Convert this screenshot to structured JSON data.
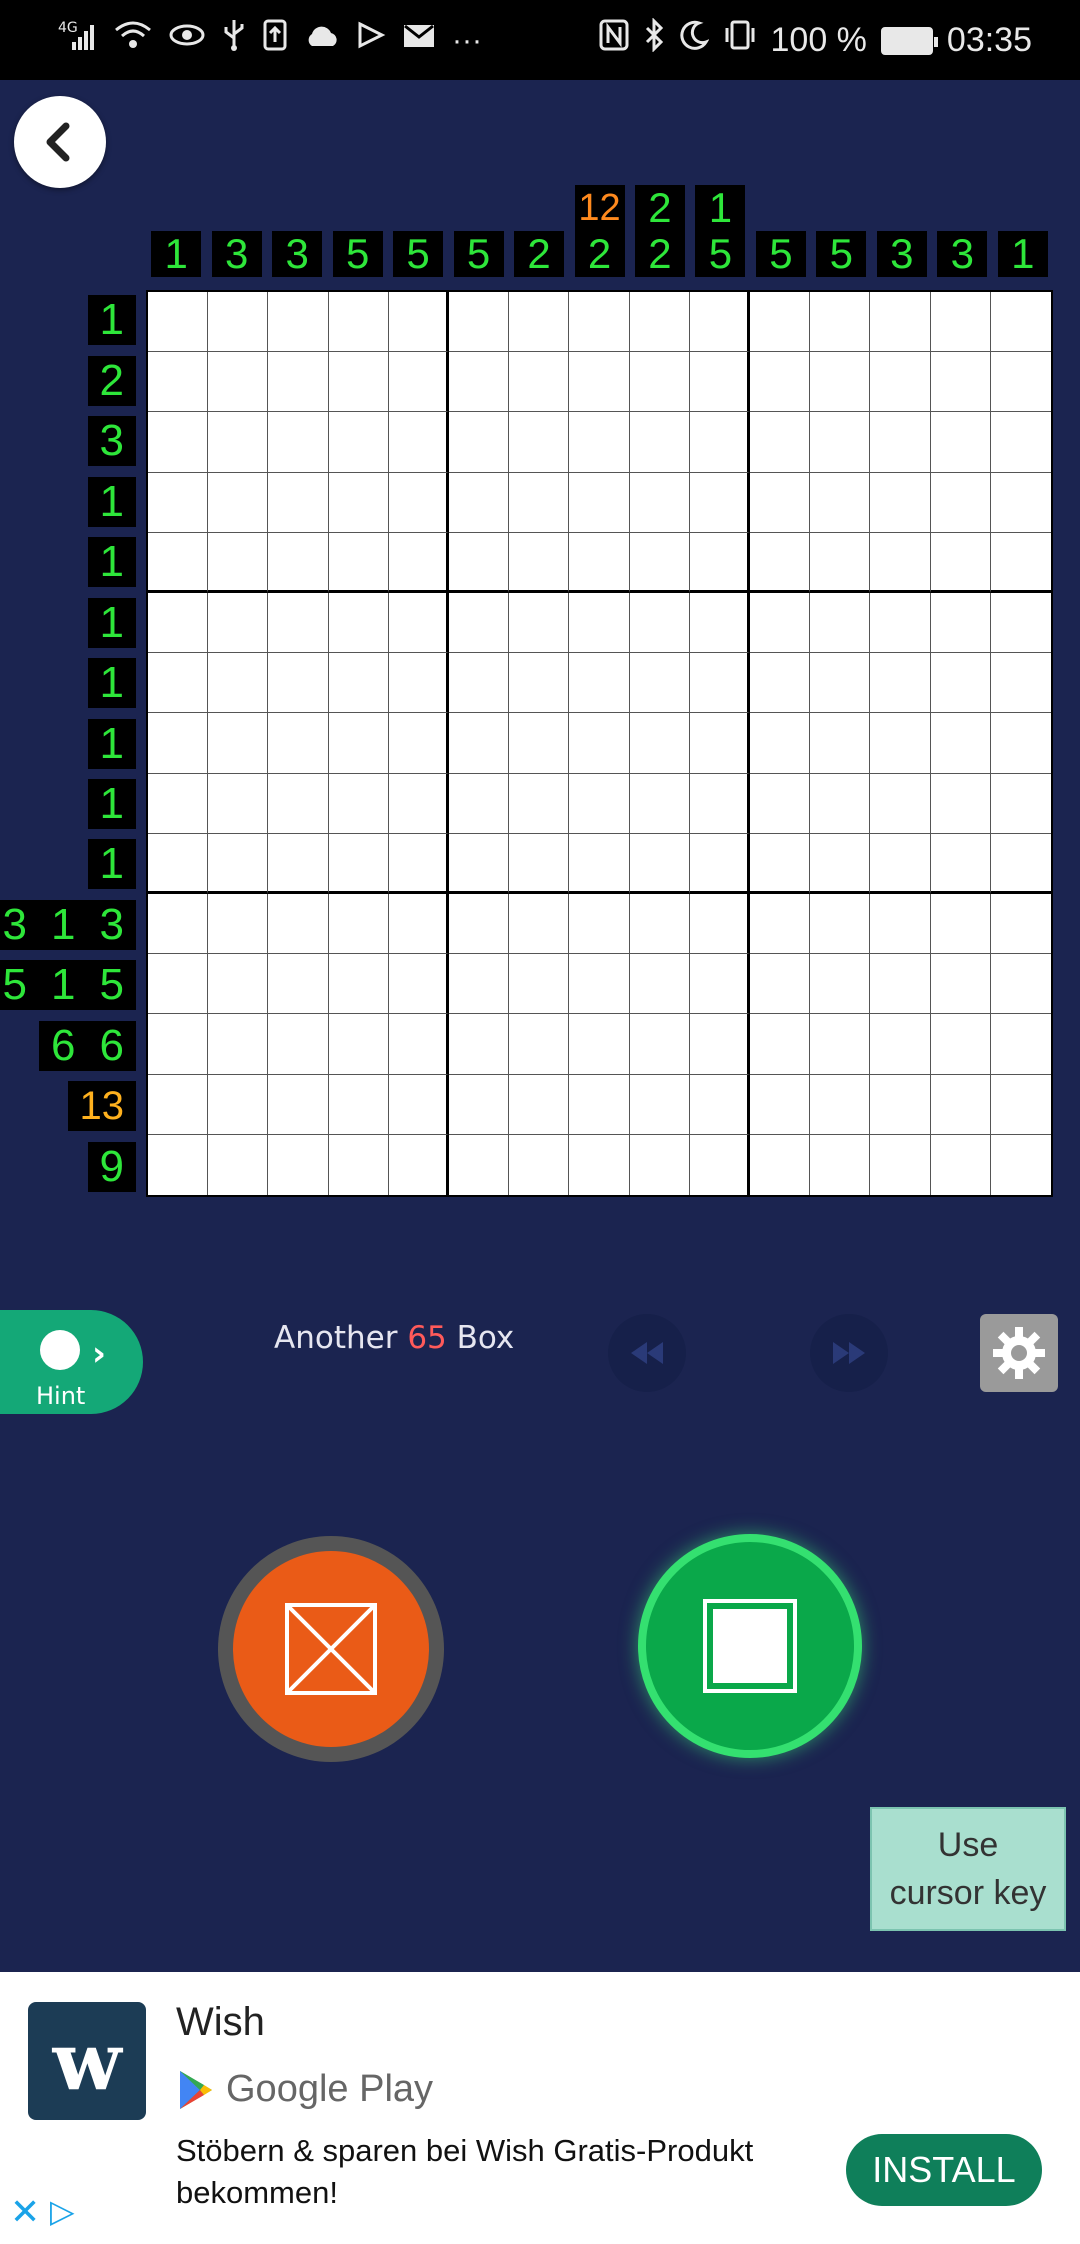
{
  "status_bar": {
    "network": "4G",
    "battery": "100 %",
    "time": "03:35",
    "left_icons": [
      "signal-icon",
      "wifi-icon",
      "eye-icon",
      "usb-icon",
      "upload-icon",
      "cloud-icon",
      "play-icon",
      "mail-icon",
      "more-icon"
    ],
    "right_icons": [
      "nfc-icon",
      "bluetooth-icon",
      "moon-icon",
      "vibrate-icon",
      "battery-icon"
    ]
  },
  "puzzle": {
    "size": 15,
    "column_clues": [
      [
        "1"
      ],
      [
        "3"
      ],
      [
        "3"
      ],
      [
        "5"
      ],
      [
        "5"
      ],
      [
        "5"
      ],
      [
        "2"
      ],
      [
        "12",
        "2"
      ],
      [
        "2",
        "2"
      ],
      [
        "1",
        "5"
      ],
      [
        "5"
      ],
      [
        "5"
      ],
      [
        "3"
      ],
      [
        "3"
      ],
      [
        "1"
      ]
    ],
    "column_clue_colors": [
      [
        "green"
      ],
      [
        "green"
      ],
      [
        "green"
      ],
      [
        "green"
      ],
      [
        "green"
      ],
      [
        "green"
      ],
      [
        "green"
      ],
      [
        "orange",
        "green"
      ],
      [
        "green",
        "green"
      ],
      [
        "green",
        "green"
      ],
      [
        "green"
      ],
      [
        "green"
      ],
      [
        "green"
      ],
      [
        "green"
      ],
      [
        "green"
      ]
    ],
    "row_clues": [
      [
        "1"
      ],
      [
        "2"
      ],
      [
        "3"
      ],
      [
        "1"
      ],
      [
        "1"
      ],
      [
        "1"
      ],
      [
        "1"
      ],
      [
        "1"
      ],
      [
        "1"
      ],
      [
        "1"
      ],
      [
        "3",
        "1",
        "3"
      ],
      [
        "5",
        "1",
        "5"
      ],
      [
        "6",
        "6"
      ],
      [
        "13"
      ],
      [
        "9"
      ]
    ],
    "row_clue_colors": [
      [
        "green"
      ],
      [
        "green"
      ],
      [
        "green"
      ],
      [
        "green"
      ],
      [
        "green"
      ],
      [
        "green"
      ],
      [
        "green"
      ],
      [
        "green"
      ],
      [
        "green"
      ],
      [
        "green"
      ],
      [
        "green",
        "green",
        "green"
      ],
      [
        "green",
        "green",
        "green"
      ],
      [
        "green",
        "green"
      ],
      [
        "orange"
      ],
      [
        "green"
      ]
    ]
  },
  "controls": {
    "hint_label": "Hint",
    "another_prefix": "Another",
    "another_count": "65",
    "another_suffix": "Box",
    "use_cursor_line1": "Use",
    "use_cursor_line2": "cursor key"
  },
  "ad": {
    "app_name": "Wish",
    "store": "Google Play",
    "description": "Stöbern & sparen bei Wish Gratis-Produkt bekommen!",
    "install_label": "INSTALL"
  }
}
